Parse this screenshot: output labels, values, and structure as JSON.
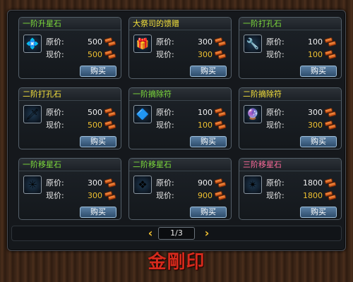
{
  "colors": {
    "title_green": "#7ddc3a",
    "title_yellow": "#f5e13a",
    "title_pink": "#ff6a9a",
    "current_price": "#f0c030",
    "button_blue": "#3c5f82"
  },
  "labels": {
    "original_price": "原价:",
    "current_price": "现价:",
    "buy": "购买"
  },
  "items": [
    {
      "name": "一阶升星石",
      "title_color": "#7ddc3a",
      "icon": "blue-crystal-icon",
      "glyph": "💠",
      "original": "500",
      "current": "500"
    },
    {
      "name": "大祭司的馈赠",
      "title_color": "#f5e13a",
      "icon": "red-gift-box-icon",
      "glyph": "🎁",
      "original": "300",
      "current": "300"
    },
    {
      "name": "一阶打孔石",
      "title_color": "#7ddc3a",
      "icon": "drill-icon",
      "glyph": "🔧",
      "original": "100",
      "current": "100"
    },
    {
      "name": "二阶打孔石",
      "title_color": "#f5e13a",
      "icon": "drill-bit-icon",
      "glyph": "🗡",
      "original": "500",
      "current": "500"
    },
    {
      "name": "一阶摘除符",
      "title_color": "#7ddc3a",
      "icon": "blue-talisman-icon",
      "glyph": "🔷",
      "original": "100",
      "current": "100"
    },
    {
      "name": "二阶摘除符",
      "title_color": "#f5e13a",
      "icon": "purple-talisman-icon",
      "glyph": "🔮",
      "original": "300",
      "current": "300"
    },
    {
      "name": "一阶移星石",
      "title_color": "#7ddc3a",
      "icon": "green-star-stone-icon",
      "glyph": "✳",
      "original": "300",
      "current": "300"
    },
    {
      "name": "二阶移星石",
      "title_color": "#7ddc3a",
      "icon": "teal-star-stone-icon",
      "glyph": "❖",
      "original": "900",
      "current": "900"
    },
    {
      "name": "三阶移星石",
      "title_color": "#ff6a9a",
      "icon": "white-star-stone-icon",
      "glyph": "✴",
      "original": "1800",
      "current": "1800"
    }
  ],
  "pager": {
    "prev_icon": "‹",
    "next_icon": "›",
    "page": "1/3"
  },
  "logo": {
    "text": "金剛印"
  }
}
